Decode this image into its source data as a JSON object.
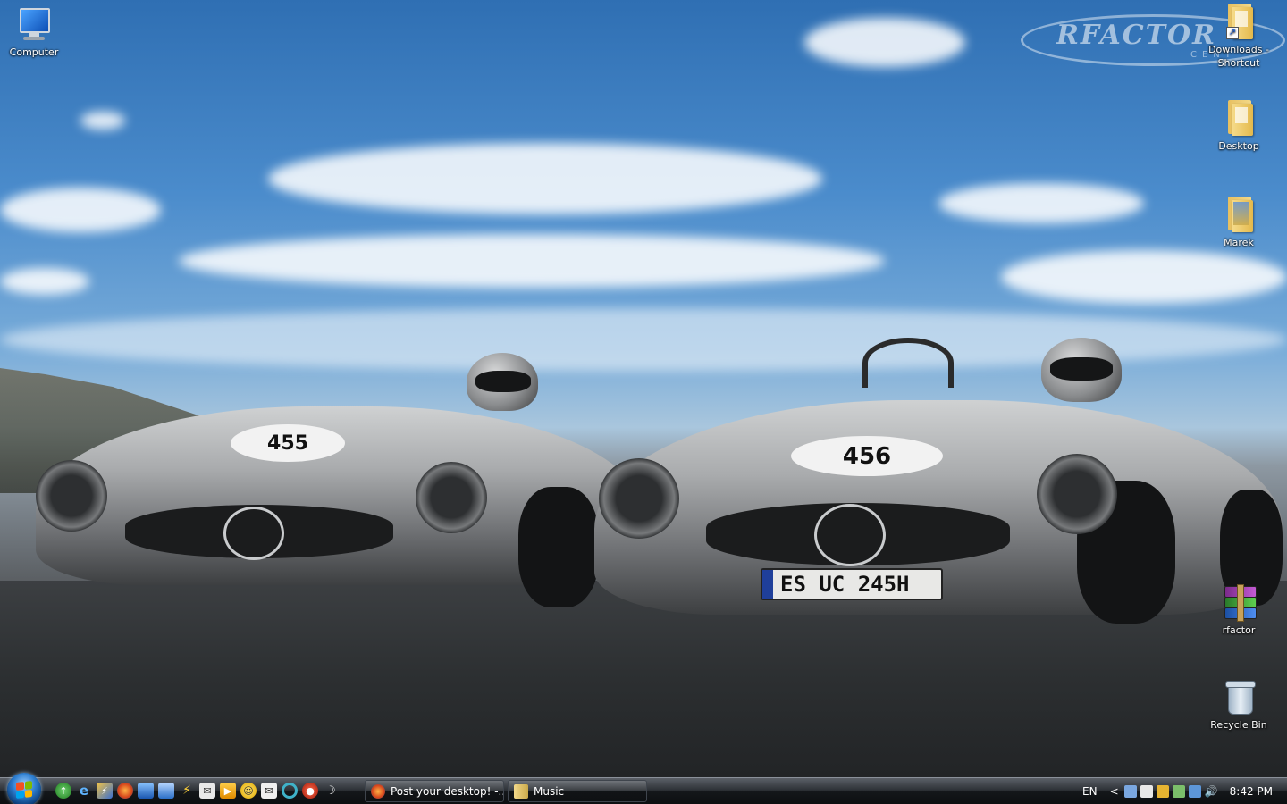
{
  "desktop": {
    "icons_left": [
      {
        "label": "Computer",
        "icon": "computer-icon"
      }
    ],
    "icons_right": [
      {
        "label": "Downloads - Shortcut",
        "icon": "folder-shortcut-icon"
      },
      {
        "label": "Desktop",
        "icon": "folder-icon"
      },
      {
        "label": "Marek",
        "icon": "user-folder-icon"
      },
      {
        "label": "rfactor",
        "icon": "winrar-archive-icon"
      },
      {
        "label": "Recycle Bin",
        "icon": "recycle-bin-icon"
      }
    ]
  },
  "wallpaper": {
    "logo_text": "RFACTOR",
    "logo_subtext": "CENT",
    "car_left_number": "455",
    "car_right_number": "456",
    "plate_text": "ES UC 245H"
  },
  "taskbar": {
    "start_icon": "windows-start-orb",
    "quick_launch": [
      "update-icon",
      "internet-explorer-icon",
      "winamp-icon",
      "firefox-icon",
      "show-desktop-icon",
      "switch-windows-icon",
      "lightning-icon",
      "mail-icon",
      "media-player-icon",
      "smiley-icon",
      "messenger-icon",
      "chrome-ring-icon",
      "record-icon",
      "moon-icon"
    ],
    "tasks": [
      {
        "label": "Post your desktop! -...",
        "icon": "firefox-icon"
      },
      {
        "label": "Music",
        "icon": "music-folder-icon"
      }
    ],
    "tray": {
      "language": "EN",
      "expand_arrow": "<",
      "icons": [
        "headset-icon",
        "display-icon",
        "lightning-icon",
        "users-icon",
        "network-icon",
        "volume-icon"
      ],
      "time": "8:42 PM"
    }
  },
  "colors": {
    "taskbar_top": "#5b6068",
    "taskbar_bottom": "#0c0e10",
    "sky": "#4b8ccc",
    "start_orb": "#2e7fd1"
  }
}
